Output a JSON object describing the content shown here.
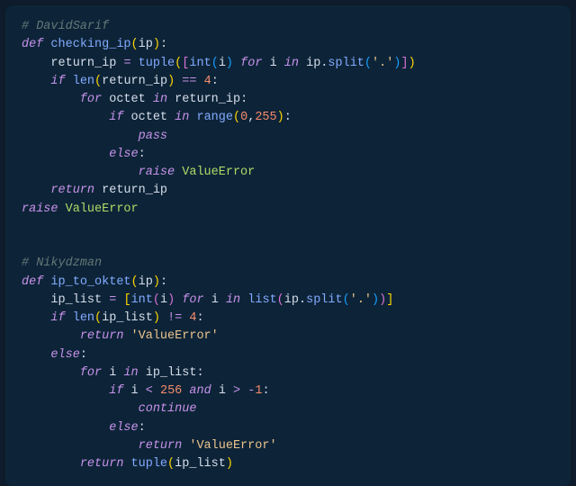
{
  "code1": {
    "comment": "# DavidSarif",
    "def": "def",
    "fn": "checking_ip",
    "param": "ip",
    "var1": "return_ip",
    "tuple": "tuple",
    "int": "int",
    "i": "i",
    "for": "for",
    "in": "in",
    "split": "split",
    "dot": "'.'",
    "if": "if",
    "len": "len",
    "eq": "==",
    "four": "4",
    "octet": "octet",
    "range": "range",
    "zero": "0",
    "r255": "255",
    "pass": "pass",
    "else": "else",
    "raise": "raise",
    "valueerror": "ValueError",
    "return": "return"
  },
  "code2": {
    "comment": "# Nikydzman",
    "def": "def",
    "fn": "ip_to_oktet",
    "param": "ip",
    "var1": "ip_list",
    "int": "int",
    "i": "i",
    "for": "for",
    "in": "in",
    "list": "list",
    "split": "split",
    "dot": "'.'",
    "if": "if",
    "len": "len",
    "neq": "!=",
    "four": "4",
    "return": "return",
    "vestr": "'ValueError'",
    "else": "else",
    "lt": "<",
    "r256": "256",
    "and": "and",
    "gt": ">",
    "neg1": "-1",
    "continue": "continue",
    "tuple": "tuple"
  }
}
